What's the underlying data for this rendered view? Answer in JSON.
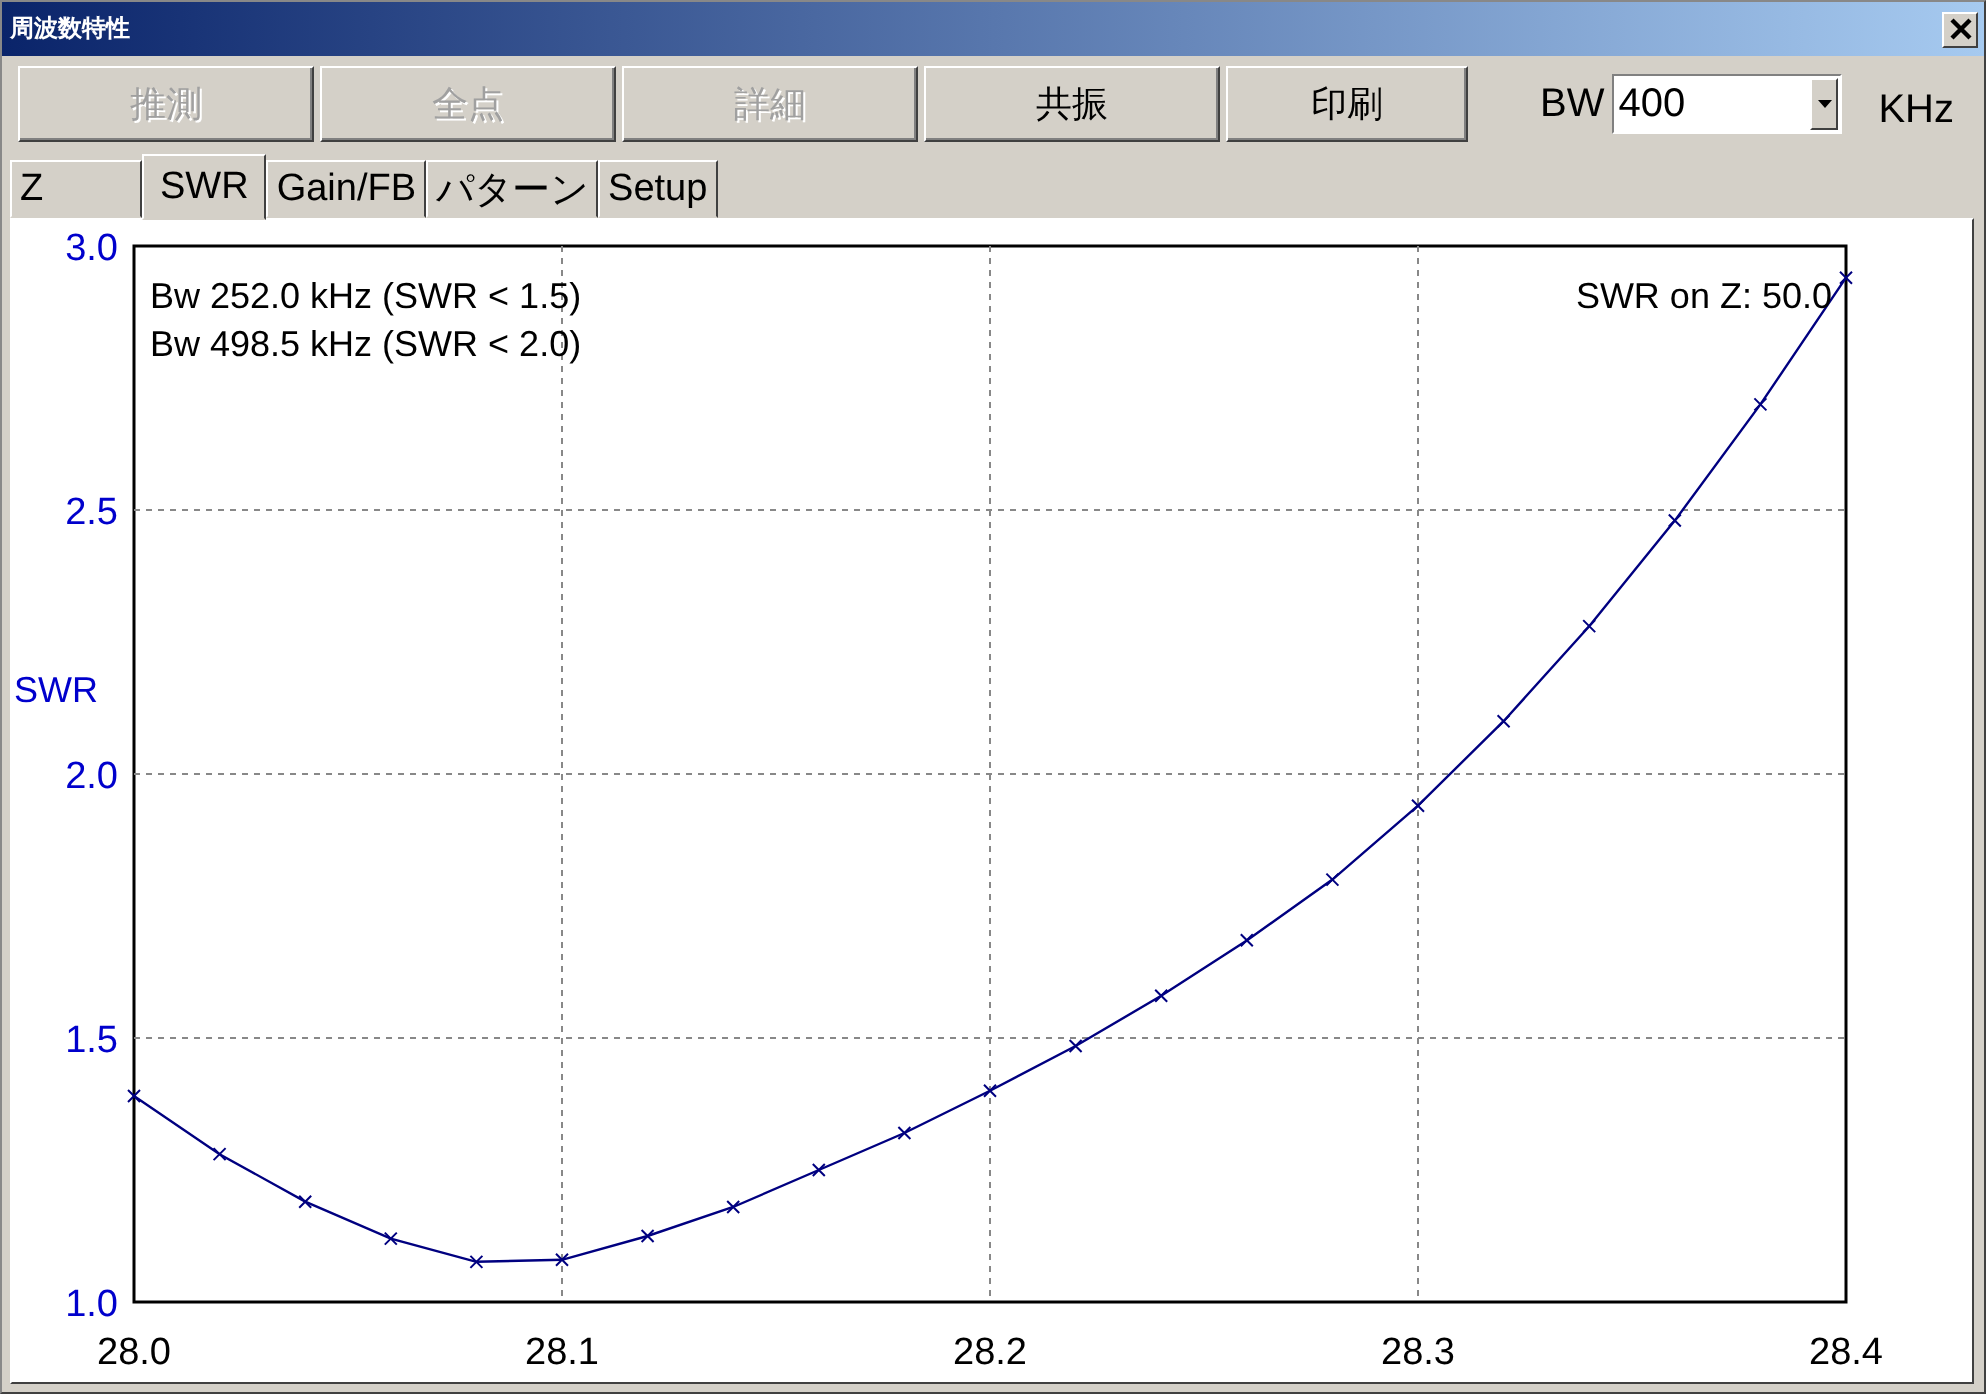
{
  "window": {
    "title": "周波数特性"
  },
  "toolbar": {
    "buttons": [
      {
        "label": "推測",
        "disabled": true
      },
      {
        "label": "全点",
        "disabled": true
      },
      {
        "label": "詳細",
        "disabled": true
      },
      {
        "label": "共振",
        "disabled": false
      },
      {
        "label": "印刷",
        "disabled": false
      }
    ],
    "bw": {
      "label": "BW",
      "value": "400",
      "unit": "KHz"
    }
  },
  "tabs": [
    {
      "label": "Z",
      "selected": false
    },
    {
      "label": "SWR",
      "selected": true
    },
    {
      "label": "Gain/FB",
      "selected": false
    },
    {
      "label": "パターン",
      "selected": false
    },
    {
      "label": "Setup",
      "selected": false
    }
  ],
  "chart": {
    "annotations": [
      "Bw 252.0 kHz (SWR < 1.5)",
      "Bw 498.5 kHz (SWR < 2.0)"
    ],
    "note": "SWR on Z: 50.0",
    "chart_data": {
      "type": "line",
      "ylabel": "SWR",
      "x": [
        28.0,
        28.02,
        28.04,
        28.06,
        28.08,
        28.1,
        28.12,
        28.14,
        28.16,
        28.18,
        28.2,
        28.22,
        28.24,
        28.26,
        28.28,
        28.3,
        28.32,
        28.34,
        28.36,
        28.38,
        28.4
      ],
      "grid": true,
      "series": [
        {
          "color": "#000080",
          "marker": "x",
          "values": [
            1.39,
            1.28,
            1.19,
            1.12,
            1.076,
            1.08,
            1.125,
            1.18,
            1.25,
            1.32,
            1.4,
            1.485,
            1.58,
            1.685,
            1.8,
            1.94,
            2.1,
            2.28,
            2.48,
            2.7,
            2.94
          ]
        }
      ],
      "xlim": [
        28.0,
        28.4
      ],
      "ylim": [
        1.0,
        3.0
      ],
      "xticks": [
        {
          "value": 28.0,
          "label": "28.0"
        },
        {
          "value": 28.1,
          "label": "28.1"
        },
        {
          "value": 28.2,
          "label": "28.2"
        },
        {
          "value": 28.3,
          "label": "28.3"
        },
        {
          "value": 28.4,
          "label": "28.4"
        }
      ],
      "yticks": [
        {
          "value": 1.0,
          "label": "1.0"
        },
        {
          "value": 1.5,
          "label": "1.5"
        },
        {
          "value": 2.0,
          "label": "2.0"
        },
        {
          "value": 2.5,
          "label": "2.5"
        },
        {
          "value": 3.0,
          "label": "3.0"
        }
      ]
    }
  }
}
